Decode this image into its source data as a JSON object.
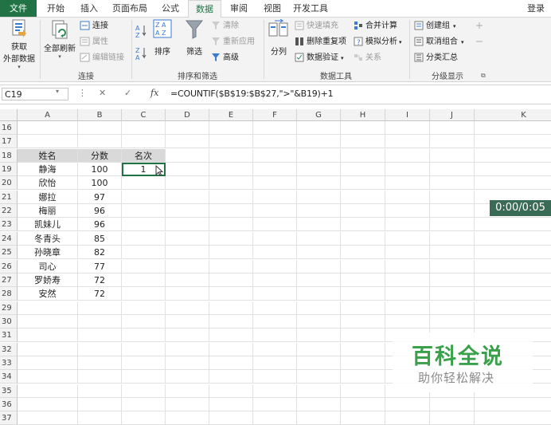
{
  "tabs": {
    "file": "文件",
    "items": [
      "开始",
      "插入",
      "页面布局",
      "公式",
      "数据",
      "审阅",
      "视图",
      "开发工具"
    ],
    "active": "数据",
    "login": "登录"
  },
  "ribbon": {
    "get_external": {
      "line1": "获取",
      "line2": "外部数据"
    },
    "connections": {
      "refresh_all": "全部刷新",
      "connect": "连接",
      "properties": "属性",
      "edit_links": "编辑链接",
      "label": "连接"
    },
    "sort_filter": {
      "sort": "排序",
      "filter": "筛选",
      "clear": "清除",
      "reapply": "重新应用",
      "advanced": "高级",
      "label": "排序和筛选"
    },
    "data_tools": {
      "text_to_columns": "分列",
      "flash_fill": "快速填充",
      "remove_duplicates": "删除重复项",
      "data_validation": "数据验证",
      "consolidate": "合并计算",
      "what_if": "模拟分析",
      "relationships": "关系",
      "label": "数据工具"
    },
    "outline": {
      "group": "创建组",
      "ungroup": "取消组合",
      "subtotal": "分类汇总",
      "label": "分级显示"
    }
  },
  "formula_bar": {
    "name_box": "C19",
    "fx": "fx",
    "formula": "=COUNTIF($B$19:$B$27,\">\"&B19)+1"
  },
  "sheet": {
    "columns": [
      "A",
      "B",
      "C",
      "D",
      "E",
      "F",
      "G",
      "H",
      "I",
      "J",
      "K"
    ],
    "rows": [
      "16",
      "17",
      "18",
      "19",
      "20",
      "21",
      "22",
      "23",
      "24",
      "25",
      "26",
      "27",
      "28",
      "29",
      "30",
      "31",
      "32",
      "33",
      "34",
      "35",
      "36",
      "37"
    ],
    "header": {
      "name": "姓名",
      "score": "分数",
      "rank": "名次"
    },
    "records": [
      {
        "name": "静海",
        "score": "100",
        "rank": "1"
      },
      {
        "name": "欣怡",
        "score": "100",
        "rank": ""
      },
      {
        "name": "娜拉",
        "score": "97",
        "rank": ""
      },
      {
        "name": "梅丽",
        "score": "96",
        "rank": ""
      },
      {
        "name": "凯妹儿",
        "score": "96",
        "rank": ""
      },
      {
        "name": "冬青头",
        "score": "85",
        "rank": ""
      },
      {
        "name": "孙晓章",
        "score": "82",
        "rank": ""
      },
      {
        "name": "司心",
        "score": "77",
        "rank": ""
      },
      {
        "name": "罗娇寿",
        "score": "72",
        "rank": ""
      },
      {
        "name": "安然",
        "score": "72",
        "rank": ""
      }
    ]
  },
  "overlay": {
    "timer": "0:00/0:05",
    "watermark_title": "百科全说",
    "watermark_sub": "助你轻松解决"
  },
  "colors": {
    "excel_green": "#217346",
    "header_fill": "#d9d9d9",
    "watermark_green": "#39a14a"
  }
}
